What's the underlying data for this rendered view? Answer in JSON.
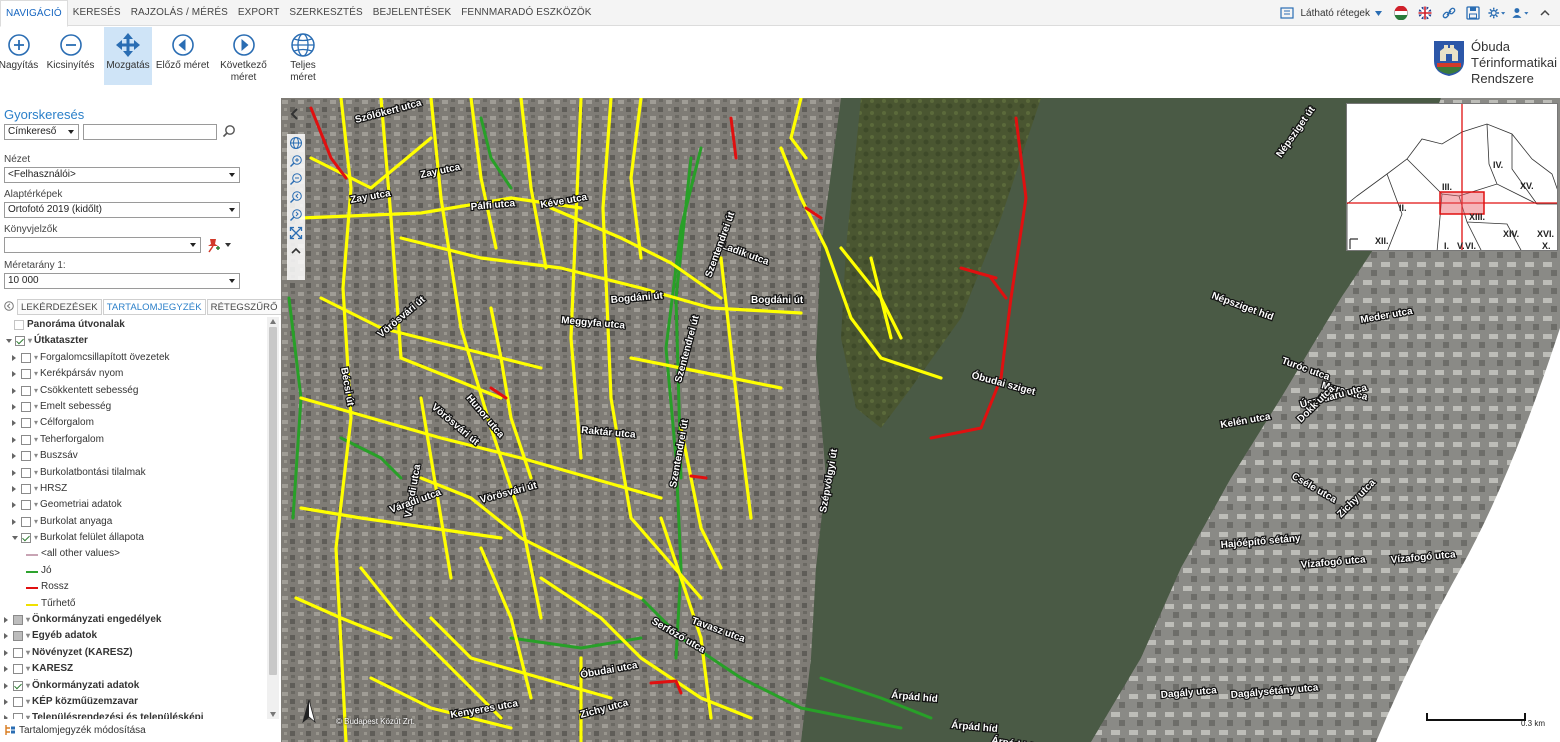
{
  "menu": {
    "tabs": [
      "NAVIGÁCIÓ",
      "KERESÉS",
      "RAJZOLÁS / MÉRÉS",
      "EXPORT",
      "SZERKESZTÉS",
      "BEJELENTÉSEK",
      "FENNMARADÓ ESZKÖZÖK"
    ],
    "active_tab": "NAVIGÁCIÓ",
    "visible_layers_label": "Látható rétegek"
  },
  "toolbar": {
    "zoom_in": "Nagyítás",
    "zoom_out": "Kicsinyítés",
    "pan": "Mozgatás",
    "prev_extent": "Előző méret",
    "next_extent_1": "Következő",
    "next_extent_2": "méret",
    "full_extent": "Teljes méret"
  },
  "logo": {
    "line1": "Óbuda",
    "line2": "Térinformatikai",
    "line3": "Rendszere"
  },
  "quicksearch": {
    "title": "Gyorskeresés",
    "mode": "Címkereső",
    "query": ""
  },
  "view": {
    "label": "Nézet",
    "value": "<Felhasználói>"
  },
  "basemap": {
    "label": "Alaptérképek",
    "value": "Ortofotó 2019 (kidőlt)"
  },
  "bookmarks": {
    "label": "Könyvjelzők",
    "value": ""
  },
  "scale": {
    "label": "Méretarány 1:",
    "value": "10 000"
  },
  "panel_tabs": [
    "LEKÉRDEZÉSEK",
    "TARTALOMJEGYZÉK",
    "RÉTEGSZŰRŐ"
  ],
  "panel_active_tab": "TARTALOMJEGYZÉK",
  "toc": [
    {
      "label": "Panoráma útvonalak",
      "bold": true
    },
    {
      "label": "Útkataszter",
      "bold": true
    },
    {
      "label": "Forgalomcsillapított övezetek"
    },
    {
      "label": "Kerékpársáv nyom"
    },
    {
      "label": "Csökkentett sebesség"
    },
    {
      "label": "Emelt sebesség"
    },
    {
      "label": "Célforgalom"
    },
    {
      "label": "Teherforgalom"
    },
    {
      "label": "Buszsáv"
    },
    {
      "label": "Burkolatbontási tilalmak"
    },
    {
      "label": "HRSZ"
    },
    {
      "label": "Geometriai adatok"
    },
    {
      "label": "Burkolat anyaga"
    },
    {
      "label": "Burkolat felület állapota"
    },
    {
      "label": "<all other values>",
      "color": "#c8a4b4"
    },
    {
      "label": "Jó",
      "color": "#2ea32e"
    },
    {
      "label": "Rossz",
      "color": "#e01010"
    },
    {
      "label": "Tűrhető",
      "color": "#f0e000"
    },
    {
      "label": "Önkormányzati engedélyek",
      "bold": true
    },
    {
      "label": "Egyéb adatok",
      "bold": true
    },
    {
      "label": "Növényzet (KARESZ)",
      "bold": true
    },
    {
      "label": "KARESZ",
      "bold": true
    },
    {
      "label": "Önkormányzati adatok",
      "bold": true
    },
    {
      "label": "KÉP közműüzemzavar",
      "bold": true
    },
    {
      "label": "Településrendezési és településképi",
      "bold": true
    }
  ],
  "toc_footer": "Tartalomjegyzék módosítása",
  "map": {
    "copyright": "© Budapest Közút Zrt.",
    "scale_label": "0.3 km",
    "colors": {
      "water": "#4a5a45",
      "vegetation": "#4d5a33",
      "urban": "#7c7a74",
      "road_fair": "#ffff00",
      "road_good": "#28a028",
      "road_bad": "#e01010"
    },
    "street_labels": [
      "Szőlőkert utca",
      "Zay utca",
      "Zay utca",
      "Pálfi utca",
      "Kéve utca",
      "Ladik utca",
      "Bogdáni út",
      "Bogdáni út",
      "Meggyfa utca",
      "Bécsi út",
      "Vörösvári út",
      "Vörösvári út",
      "Vörösvári út",
      "Szentendrei út",
      "Szentendrei út",
      "Szentendrei út",
      "Hunor utca",
      "Raktár utca",
      "Váradi utca",
      "Váradi utca",
      "Serfőző utca",
      "Tavasz utca",
      "Szépvölgyi út",
      "Óbudai sziget",
      "Népsziget híd",
      "Népsziget út",
      "Meder utca",
      "Turóc utca",
      "Mura utca",
      "Úszódaru utca",
      "Kelén utca",
      "Dokk utca",
      "Cséle utca",
      "Zichy utca",
      "Hajóépítő sétány",
      "Vízafogó utca",
      "Vízafogó utca",
      "Dagály utca",
      "Dagálysétány utca",
      "Árpád híd",
      "Árpád híd",
      "Árpád híd",
      "Kenyeres utca",
      "Óbudai utca",
      "Zichy utca"
    ],
    "overview_labels": [
      "III.",
      "II.",
      "IV.",
      "XV.",
      "XIII.",
      "XIV.",
      "XVI.",
      "X.",
      "XII.",
      "I.",
      "V.",
      "VI."
    ]
  }
}
